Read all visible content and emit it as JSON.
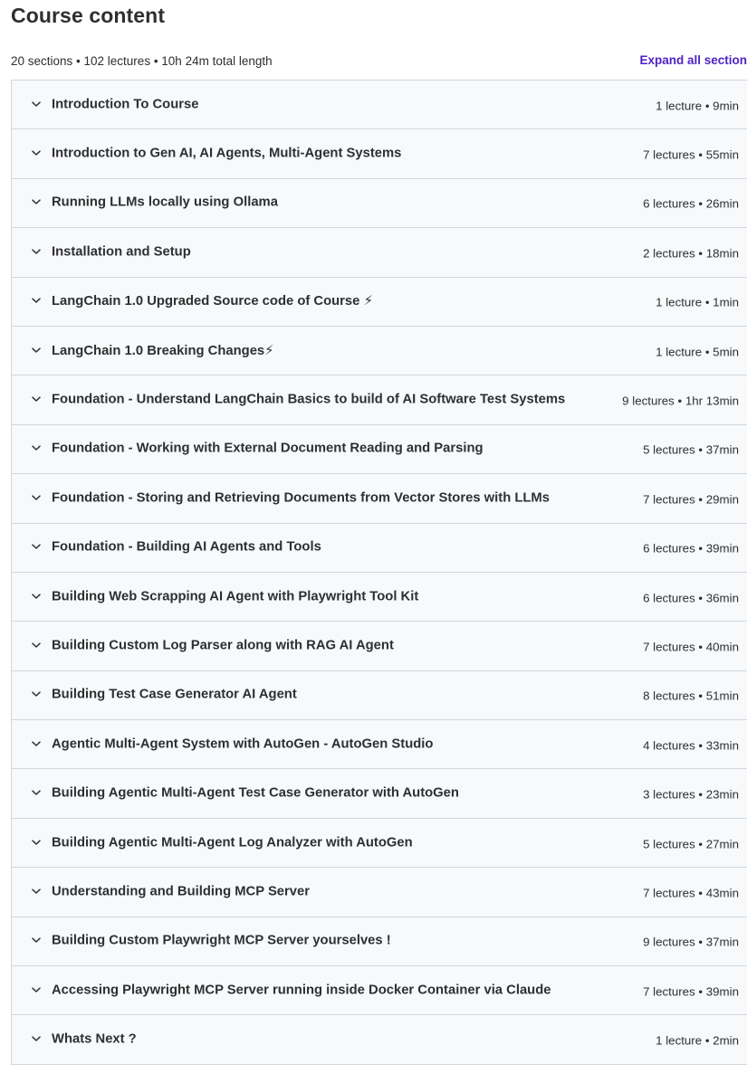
{
  "header": {
    "title": "Course content",
    "summary": "20 sections • 102 lectures • 10h 24m total length",
    "expand_all_label": "Expand all section"
  },
  "colors": {
    "accent": "#5022c3",
    "row_background": "#f7f9fa",
    "border": "#d1d7dc",
    "text": "#2d2f31"
  },
  "sections": [
    {
      "title": "Introduction To Course",
      "meta": "1 lecture • 9min"
    },
    {
      "title": "Introduction to Gen AI, AI Agents, Multi-Agent Systems",
      "meta": "7 lectures • 55min"
    },
    {
      "title": "Running LLMs locally using Ollama",
      "meta": "6 lectures • 26min"
    },
    {
      "title": "Installation and Setup",
      "meta": "2 lectures • 18min"
    },
    {
      "title": "LangChain 1.0 Upgraded Source code of Course ⚡",
      "meta": "1 lecture • 1min"
    },
    {
      "title": "LangChain 1.0 Breaking Changes⚡",
      "meta": "1 lecture • 5min"
    },
    {
      "title": "Foundation - Understand LangChain Basics to build of AI Software Test Systems",
      "meta": "9 lectures • 1hr 13min"
    },
    {
      "title": "Foundation - Working with External Document Reading and Parsing",
      "meta": "5 lectures • 37min"
    },
    {
      "title": "Foundation - Storing and Retrieving Documents from Vector Stores with LLMs",
      "meta": "7 lectures • 29min"
    },
    {
      "title": "Foundation - Building AI Agents and Tools",
      "meta": "6 lectures • 39min"
    },
    {
      "title": "Building Web Scrapping AI Agent with Playwright Tool Kit",
      "meta": "6 lectures • 36min"
    },
    {
      "title": "Building Custom Log Parser along with RAG AI Agent",
      "meta": "7 lectures • 40min"
    },
    {
      "title": "Building Test Case Generator AI Agent",
      "meta": "8 lectures • 51min"
    },
    {
      "title": "Agentic Multi-Agent System with AutoGen - AutoGen Studio",
      "meta": "4 lectures • 33min"
    },
    {
      "title": "Building Agentic Multi-Agent Test Case Generator with AutoGen",
      "meta": "3 lectures • 23min"
    },
    {
      "title": "Building Agentic Multi-Agent Log Analyzer with AutoGen",
      "meta": "5 lectures • 27min"
    },
    {
      "title": "Understanding and Building MCP Server",
      "meta": "7 lectures • 43min"
    },
    {
      "title": "Building Custom Playwright MCP Server yourselves !",
      "meta": "9 lectures • 37min"
    },
    {
      "title": "Accessing Playwright MCP Server running inside Docker Container via Claude",
      "meta": "7 lectures • 39min"
    },
    {
      "title": "Whats Next ?",
      "meta": "1 lecture • 2min"
    }
  ]
}
